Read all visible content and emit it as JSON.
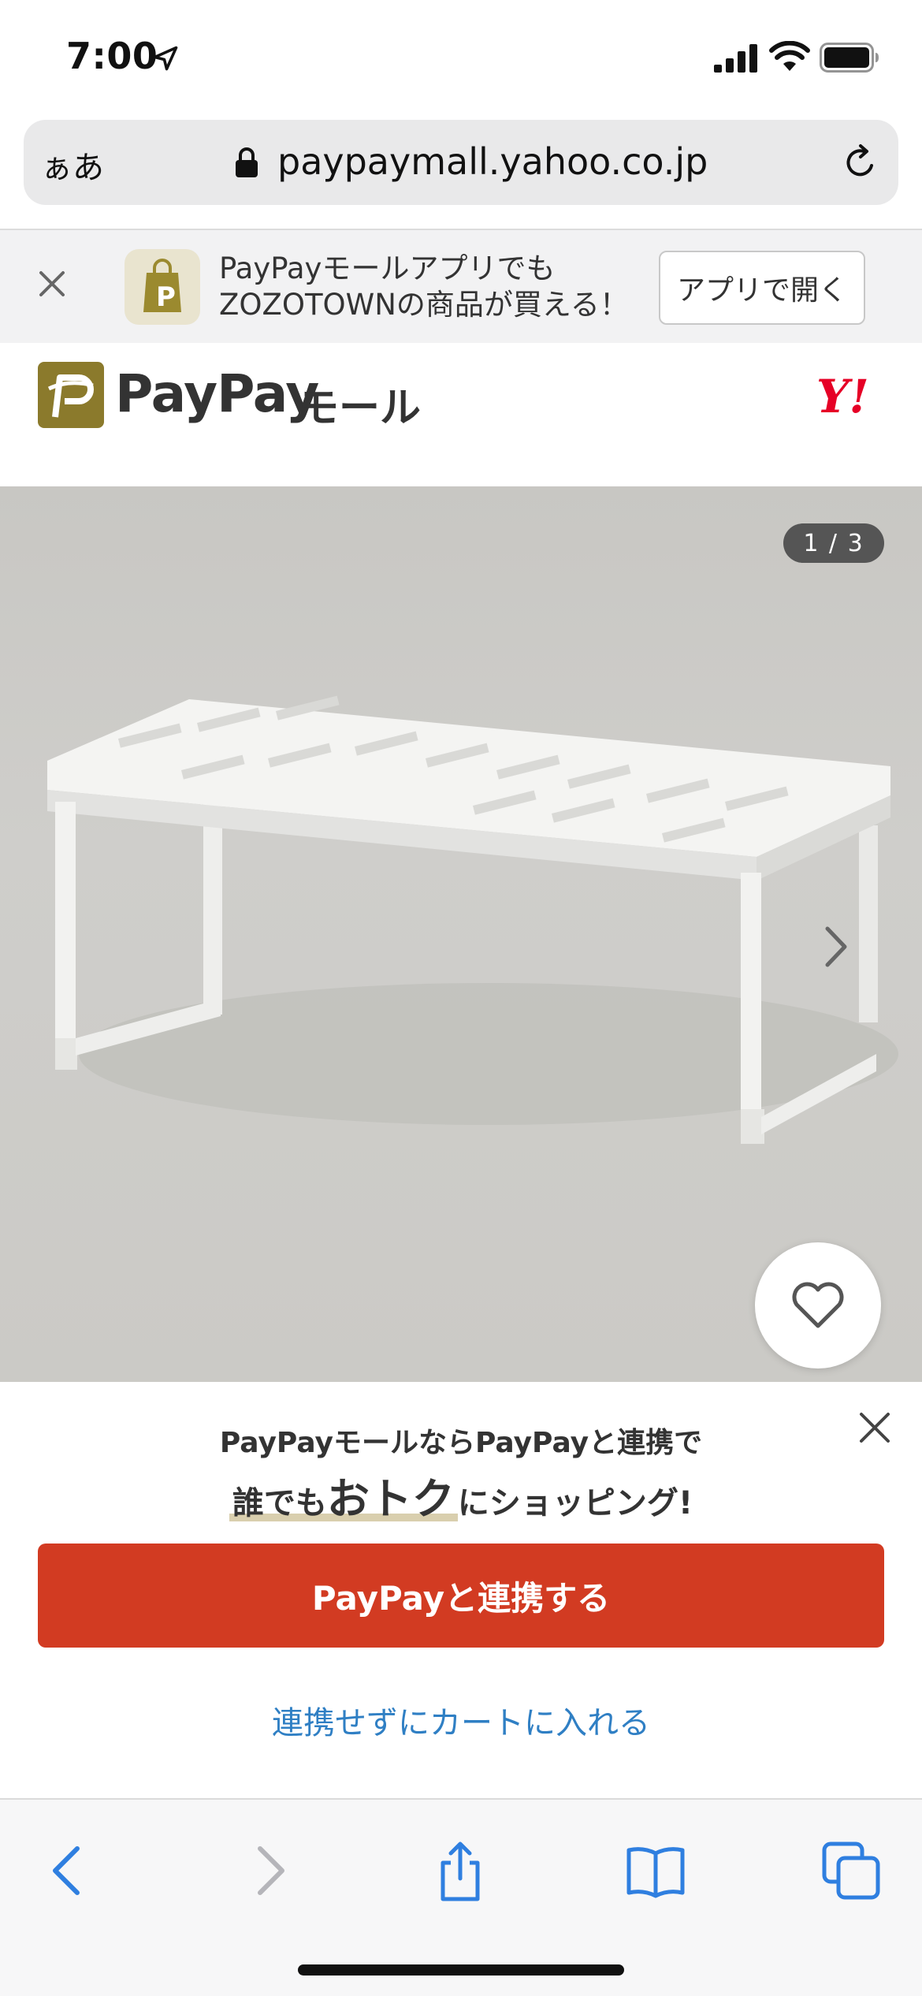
{
  "status_bar": {
    "time": "7:00",
    "icons": [
      "location-arrow-icon",
      "cellular-signal-icon",
      "wifi-icon",
      "battery-icon"
    ]
  },
  "browser": {
    "text_size_label": "ぁあ",
    "url": "paypaymall.yahoo.co.jp"
  },
  "app_banner": {
    "line1": "PayPayモールアプリでも",
    "line2": "ZOZOTOWNの商品が買える！",
    "open_label": "アプリで開く"
  },
  "header": {
    "logo_text": "PayPay",
    "logo_sub": "モール",
    "yahoo_logo": "Y!"
  },
  "product": {
    "image_counter": "1 / 3"
  },
  "link_panel": {
    "line1": "PayPayモールならPayPayと連携で",
    "line2_prefix": "誰でも",
    "line2_emphasis": "おトク",
    "line2_suffix": "にショッピング!",
    "primary_label": "PayPayと連携する",
    "secondary_label": "連携せずにカートに入れる"
  },
  "toolbar": {
    "items": [
      "back-icon",
      "forward-icon",
      "share-icon",
      "bookmarks-icon",
      "tabs-icon"
    ]
  },
  "colors": {
    "brand_red": "#d23b22",
    "link_blue": "#2f7fc4",
    "yahoo_red": "#e60026",
    "paypay_gold": "#8b7a2c"
  }
}
